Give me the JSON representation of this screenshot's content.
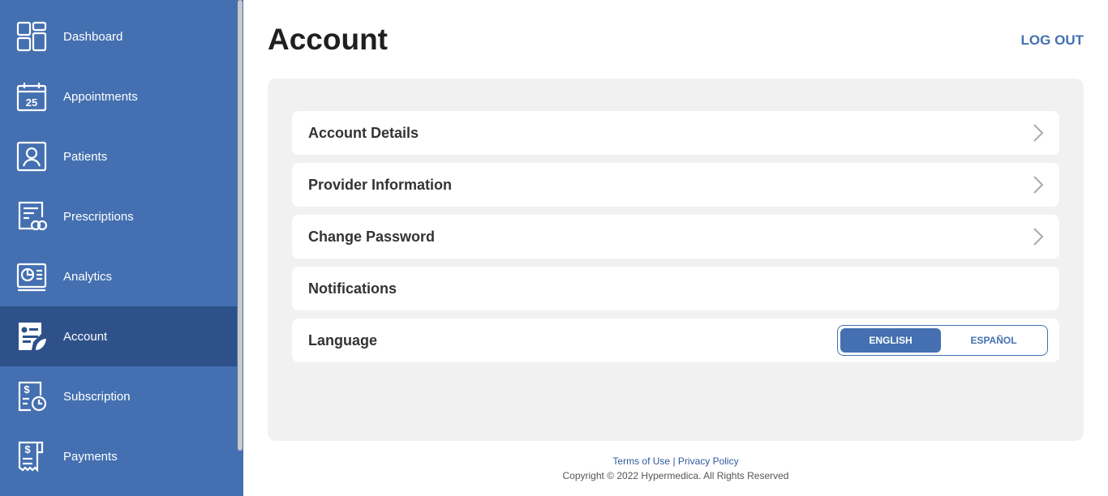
{
  "sidebar": {
    "items": [
      {
        "label": "Dashboard",
        "icon": "dashboard-icon"
      },
      {
        "label": "Appointments",
        "icon": "calendar-icon",
        "icon_text": "25"
      },
      {
        "label": "Patients",
        "icon": "patient-icon"
      },
      {
        "label": "Prescriptions",
        "icon": "prescription-icon"
      },
      {
        "label": "Analytics",
        "icon": "analytics-icon"
      },
      {
        "label": "Account",
        "icon": "account-icon",
        "active": true
      },
      {
        "label": "Subscription",
        "icon": "subscription-icon"
      },
      {
        "label": "Payments",
        "icon": "payments-icon"
      }
    ]
  },
  "header": {
    "title": "Account",
    "logout": "LOG OUT"
  },
  "panel": {
    "rows": [
      {
        "label": "Account Details",
        "has_chevron": true
      },
      {
        "label": "Provider Information",
        "has_chevron": true
      },
      {
        "label": "Change Password",
        "has_chevron": true
      },
      {
        "label": "Notifications",
        "has_chevron": false
      },
      {
        "label": "Language",
        "has_chevron": false
      }
    ],
    "language": {
      "options": [
        "ENGLISH",
        "ESPAÑOL"
      ],
      "selected": "ENGLISH"
    }
  },
  "footer": {
    "terms": "Terms of Use",
    "separator": "|",
    "privacy": "Privacy Policy",
    "copyright": "Copyright © 2022 Hypermedica. All Rights Reserved"
  },
  "colors": {
    "sidebar": "#4470b1",
    "active": "#2e5189",
    "accent": "#4470b1",
    "panel": "#f1f1f1"
  }
}
